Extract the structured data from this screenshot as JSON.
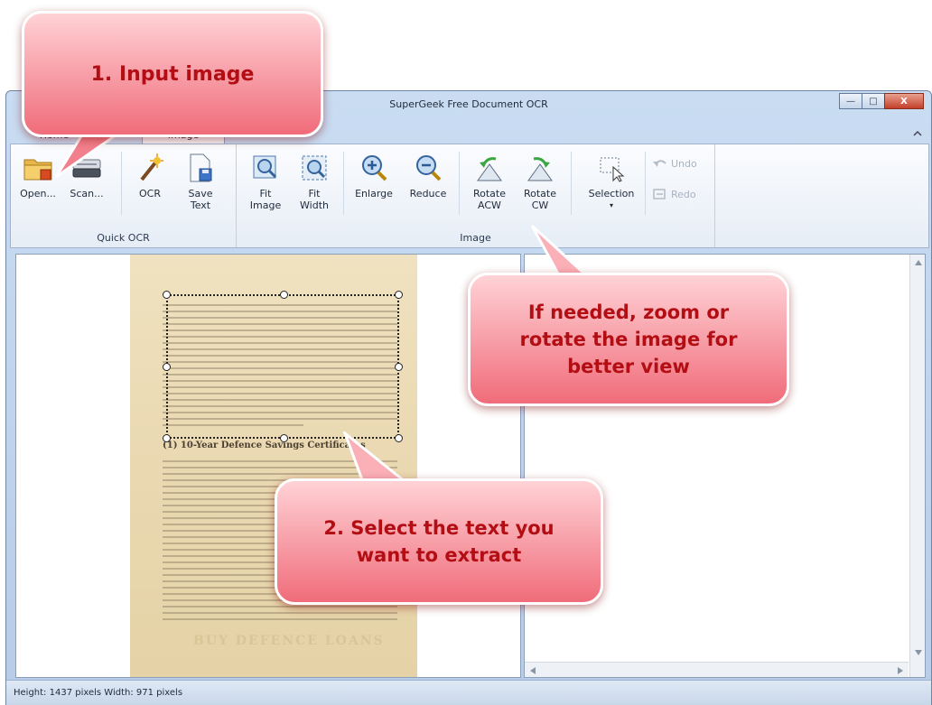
{
  "window": {
    "title": "SuperGeek Free Document OCR",
    "minimize_symbol": "—",
    "maximize_symbol": "□",
    "close_symbol": "X"
  },
  "tabs": [
    {
      "label": "Home"
    },
    {
      "label": "Image"
    }
  ],
  "ribbon": {
    "quick_ocr": {
      "label": "Quick OCR",
      "buttons": [
        {
          "label": "Open...",
          "icon": "folder-open-icon"
        },
        {
          "label": "Scan...",
          "icon": "scanner-icon"
        },
        {
          "label": "OCR",
          "icon": "magic-wand-icon"
        },
        {
          "label": "Save\nText",
          "icon": "save-text-icon"
        }
      ]
    },
    "image": {
      "label": "Image",
      "buttons": [
        {
          "label": "Fit\nImage",
          "icon": "fit-image-icon"
        },
        {
          "label": "Fit\nWidth",
          "icon": "fit-width-icon"
        },
        {
          "label": "Enlarge",
          "icon": "zoom-in-icon"
        },
        {
          "label": "Reduce",
          "icon": "zoom-out-icon"
        },
        {
          "label": "Rotate\nACW",
          "icon": "rotate-acw-icon"
        },
        {
          "label": "Rotate\nCW",
          "icon": "rotate-cw-icon"
        },
        {
          "label": "Selection",
          "icon": "selection-icon",
          "has_dropdown": true
        }
      ]
    },
    "undo_label": "Undo",
    "redo_label": "Redo",
    "dropdown_arrow": "▾"
  },
  "document": {
    "heading": "(1) 10-Year Defence Savings Certificates",
    "footer_text": "BUY DEFENCE LOANS"
  },
  "status": {
    "text": "Height: 1437 pixels  Width: 971 pixels"
  },
  "callouts": {
    "input": "1. Input image",
    "zoom": "If needed, zoom or rotate the image for better view",
    "select": "2. Select the text you want to extract"
  },
  "colors": {
    "callout_text": "#b30e14",
    "callout_fill": "#f06c7a",
    "paper": "#ead9b2"
  }
}
